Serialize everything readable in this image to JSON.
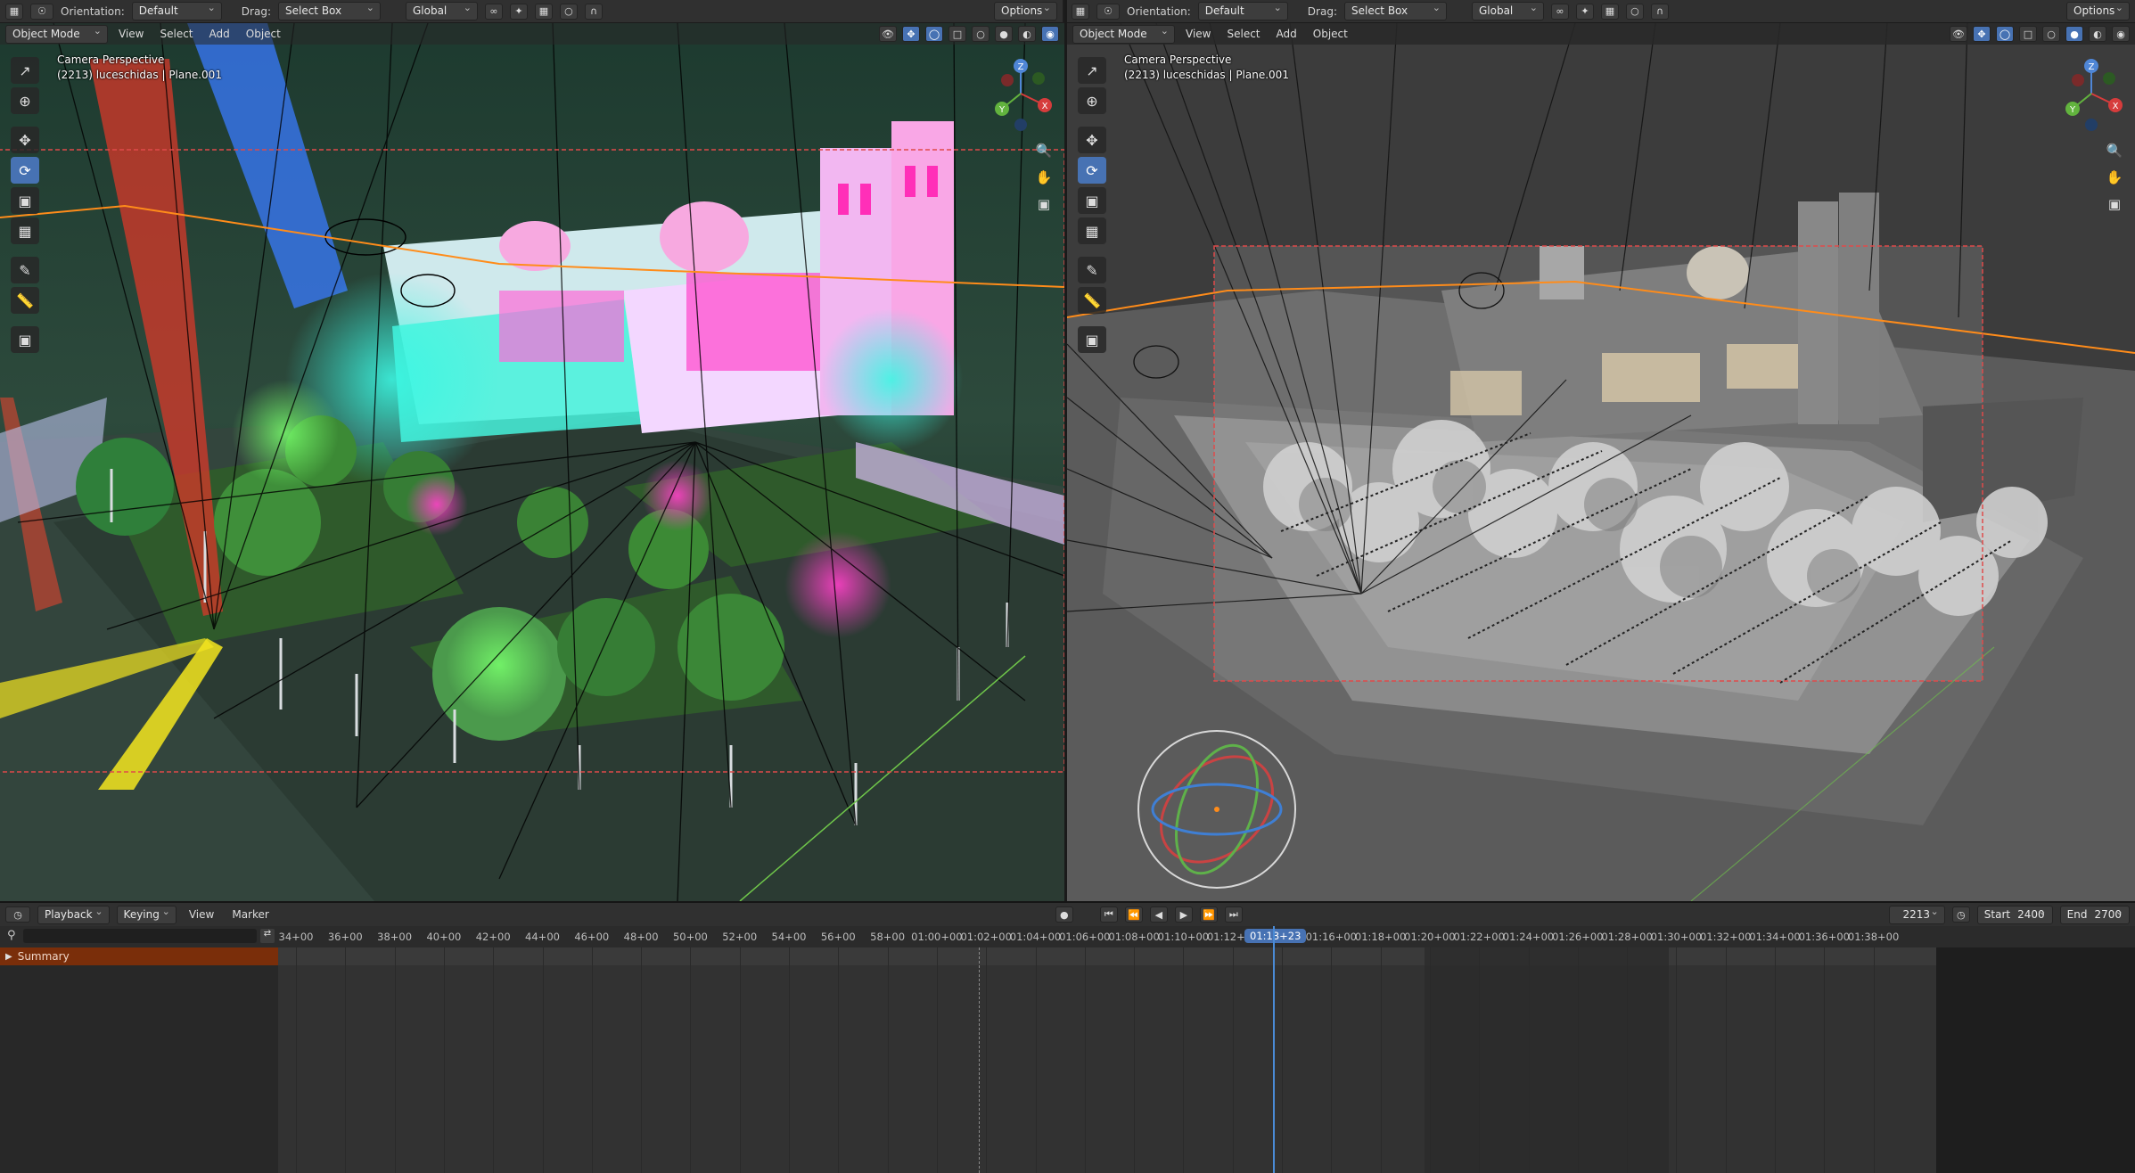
{
  "header": {
    "editor_menu": "",
    "orientation_label": "Orientation:",
    "orientation_value": "Default",
    "drag_label": "Drag:",
    "drag_value": "Select Box",
    "transform_orientation": "Global",
    "options_label": "Options"
  },
  "viewport_menu": {
    "mode": "Object Mode",
    "items": [
      "View",
      "Select",
      "Add",
      "Object"
    ]
  },
  "viewport_left": {
    "title": "Camera Perspective",
    "subtitle": "(2213) luceschidas | Plane.001"
  },
  "viewport_right": {
    "title": "Camera Perspective",
    "subtitle": "(2213) luceschidas | Plane.001"
  },
  "gizmo": {
    "x": "X",
    "y": "Y",
    "z": "Z"
  },
  "timeline": {
    "playback": "Playback",
    "keying": "Keying",
    "view": "View",
    "marker": "Marker",
    "current_frame": "2213",
    "start_label": "Start",
    "start_value": "2400",
    "end_label": "End",
    "end_value": "2700",
    "current_time": "01:13+23",
    "summary": "Summary",
    "ticks": [
      "34+00",
      "36+00",
      "38+00",
      "40+00",
      "42+00",
      "44+00",
      "46+00",
      "48+00",
      "50+00",
      "52+00",
      "54+00",
      "56+00",
      "58+00",
      "01:00+00",
      "01:02+00",
      "01:04+00",
      "01:06+00",
      "01:08+00",
      "01:10+00",
      "01:12+00",
      "01:16+00",
      "01:18+00",
      "01:20+00",
      "01:22+00",
      "01:24+00",
      "01:26+00",
      "01:28+00",
      "01:30+00",
      "01:32+00",
      "01:34+00",
      "01:36+00",
      "01:38+00"
    ]
  },
  "colors": {
    "accent": "#4772b3",
    "header_bg": "#303030",
    "summary_bg": "#7a2e0a",
    "playhead": "#4a8bd6",
    "camera_border": "#e04a4a",
    "orange_outline": "#ff8c1a"
  }
}
